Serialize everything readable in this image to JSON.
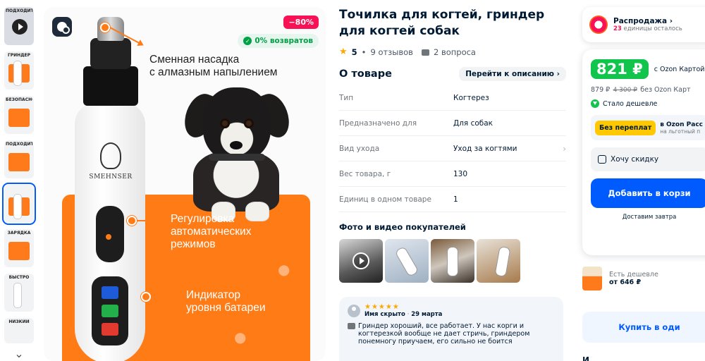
{
  "gallery": {
    "thumbnails": [
      {
        "type": "video",
        "caption": "ПОДХОДИТ"
      },
      {
        "type": "image",
        "caption": "ГРИНДЕР"
      },
      {
        "type": "image",
        "caption": "БЕЗОПАСНО"
      },
      {
        "type": "image",
        "caption": "ПОДХОДИТ"
      },
      {
        "type": "image",
        "caption": "",
        "active": true
      },
      {
        "type": "image",
        "caption": "ЗАРЯДКА"
      },
      {
        "type": "image",
        "caption": "БЫСТРО"
      },
      {
        "type": "image",
        "caption": "НИЗКИЙ"
      }
    ],
    "scroll_down_icon": "chevron-down-icon"
  },
  "hero": {
    "discount_badge": "−80%",
    "returns_badge": "0% возвратов",
    "brand": "SMEHNSER",
    "callouts": {
      "nozzle": "Сменная насадка\nс алмазным напылением",
      "modes": "Регулировка\nавтоматических\nрежимов",
      "battery": "Индикатор\nуровня батареи"
    },
    "colors": {
      "accent_orange": "#ff7b16",
      "battery_blue": "#1e5bd8",
      "battery_green": "#23b04a",
      "battery_red": "#e23a2e"
    }
  },
  "product": {
    "title": "Точилка для когтей, гриндер для когтей собак",
    "rating": "5",
    "reviews": "9 отзывов",
    "questions": "2 вопроса",
    "about_title": "О товаре",
    "about_link": "Перейти к описанию",
    "specs": [
      {
        "key": "Тип",
        "value": "Когтерез"
      },
      {
        "key": "Предназначено для",
        "value": "Для собак"
      },
      {
        "key": "Вид ухода",
        "value": "Уход за когтями"
      },
      {
        "key": "Вес товара, г",
        "value": "130"
      },
      {
        "key": "Единиц в одном товаре",
        "value": "1"
      }
    ],
    "photos_title": "Фото и видео покупателей",
    "review": {
      "stars": "★★★★★",
      "author": "Имя скрыто",
      "date": "29 марта",
      "text": "Гриндер хороший, все работает. У нас корги и когтерезкой вообще не дает стричь, гриндером понемногу приучаем, его сильно не боится"
    }
  },
  "buy": {
    "sale_title": "Распродажа",
    "sale_count": "23",
    "sale_sub": " единицы осталось",
    "ozon_price": "821 ₽",
    "ozon_card_label": "с Ozon Картой",
    "price": "879 ₽",
    "old_price": "4 300 ₽",
    "no_card_label": "без Ozon Карт",
    "cheaper_label": "Стало дешевле",
    "no_overpay_badge": "Без переплат",
    "installment_title": "в Ozon Расс",
    "installment_sub": "на льготный п",
    "want_discount": "Хочу скидку",
    "add_to_cart": "Добавить в корзи",
    "delivery": "Доставим завтра",
    "cheaper_offer_label": "Есть дешевле",
    "cheaper_offer_price": "от 646 ₽",
    "buy_one": "Купить в оди",
    "bottom_fragment": "И"
  }
}
